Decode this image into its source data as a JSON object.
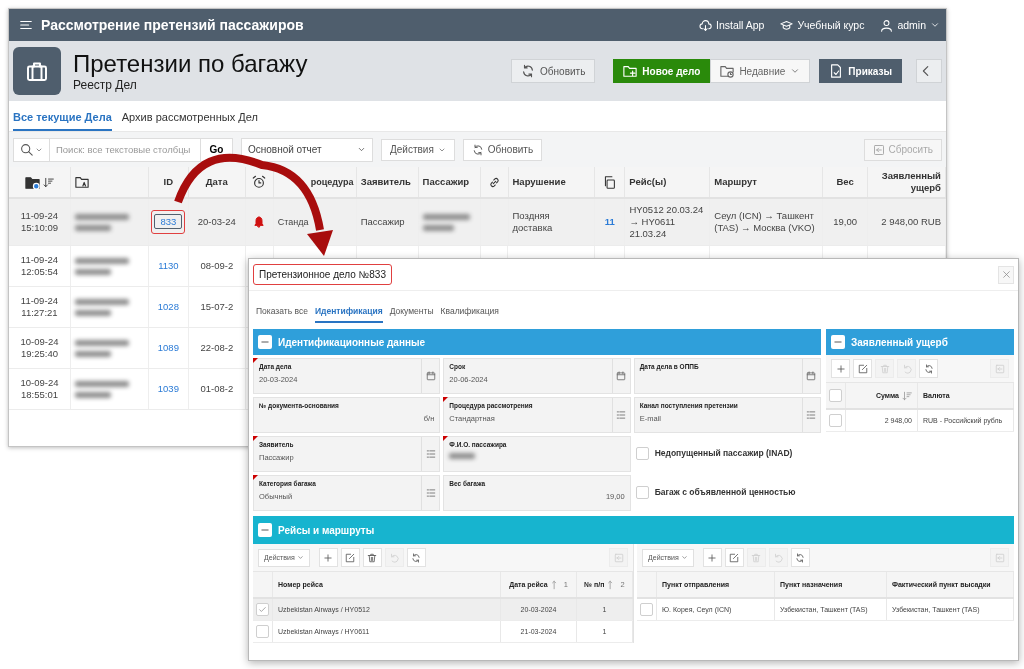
{
  "main_window": {
    "app_title": "Рассмотрение претензий пассажиров",
    "header_links": [
      {
        "kind": "install",
        "label": "Install App"
      },
      {
        "kind": "course",
        "label": "Учебный курс"
      },
      {
        "kind": "user",
        "label": "admin"
      }
    ],
    "page_title": "Претензии по багажу",
    "page_subtitle": "Реестр Дел",
    "hero_buttons": [
      {
        "kind": "refresh",
        "label": "Обновить"
      },
      {
        "kind": "new",
        "label": "Новое дело"
      },
      {
        "kind": "recent",
        "label": "Недавние"
      },
      {
        "kind": "orders",
        "label": "Приказы"
      },
      {
        "kind": "collapse"
      }
    ],
    "tabs": [
      {
        "label": "Все текущие Дела",
        "selected": true
      },
      {
        "label": "Архив рассмотренных Дел",
        "selected": false
      }
    ],
    "toolbar": {
      "search_placeholder": "Поиск: все текстовые столбцы",
      "go_label": "Go",
      "report": "Основной отчет",
      "actions_label": "Действия",
      "refresh_label": "Обновить",
      "reset_label": "Сбросить",
      "reset_disabled": true
    },
    "table": {
      "columns": [
        {
          "kind": "folder-sort"
        },
        {
          "kind": "folder"
        },
        {
          "kind": "text",
          "label": "ID"
        },
        {
          "kind": "text",
          "label": "Дата"
        },
        {
          "kind": "alarm"
        },
        {
          "kind": "text",
          "label": "роцедура"
        },
        {
          "kind": "text",
          "label": "Заявитель"
        },
        {
          "kind": "text",
          "label": "Пассажир"
        },
        {
          "kind": "link"
        },
        {
          "kind": "text",
          "label": "Нарушение"
        },
        {
          "kind": "copy"
        },
        {
          "kind": "text",
          "label": "Рейс(ы)"
        },
        {
          "kind": "text",
          "label": "Маршрут"
        },
        {
          "kind": "text",
          "label": "Вес"
        },
        {
          "kind": "text",
          "label": "Заявленный ущерб"
        }
      ],
      "rows": [
        {
          "selected": true,
          "created": "11-09-24 15:10:09",
          "applicant_hidden": true,
          "id": "833",
          "id_highlighted": true,
          "date": "20-03-24",
          "alarm": true,
          "procedure": "Станда",
          "claimant": "Пассажир",
          "passenger_hidden": true,
          "violation": "Поздняя доставка",
          "docs": "11",
          "flights": "HY0512 20.03.24 → HY0611 21.03.24",
          "route": "Сеул (ICN) → Ташкент (TAS) → Москва (VKO)",
          "weight": "19,00",
          "damage": "2 948,00 RUB"
        },
        {
          "selected": false,
          "created": "11-09-24 12:05:54",
          "applicant_hidden": true,
          "id": "1130",
          "date": "08-09-2"
        },
        {
          "selected": false,
          "created": "11-09-24 11:27:21",
          "applicant_hidden": true,
          "id": "1028",
          "date": "15-07-2"
        },
        {
          "selected": false,
          "created": "10-09-24 19:25:40",
          "applicant_hidden": true,
          "id": "1089",
          "date": "22-08-2"
        },
        {
          "selected": false,
          "created": "10-09-24 18:55:01",
          "applicant_hidden": true,
          "id": "1039",
          "date": "01-08-2"
        }
      ]
    }
  },
  "dialog": {
    "title": "Претензионное дело №833",
    "title_highlighted": true,
    "tabs": [
      {
        "label": "Показать все",
        "selected": false
      },
      {
        "label": "Идентификация",
        "selected": true
      },
      {
        "label": "Документы",
        "selected": false
      },
      {
        "label": "Квалификация",
        "selected": false
      }
    ],
    "identification": {
      "title": "Идентификационные данные",
      "fields": [
        {
          "kind": "date",
          "label": "Дата дела",
          "value": "20-03-2024",
          "required": true
        },
        {
          "kind": "date",
          "label": "Срок",
          "value": "20-06-2024",
          "required": false
        },
        {
          "kind": "date",
          "label": "Дата дела в ОППБ",
          "required": false
        },
        {
          "kind": "number",
          "label": "№ документа-основания",
          "value": "б/н",
          "required": false
        },
        {
          "kind": "select",
          "label": "Процедура рассмотрения",
          "value": "Стандартная",
          "required": true
        },
        {
          "kind": "select",
          "label": "Канал поступления претензии",
          "value": "E-mail",
          "required": false
        },
        {
          "kind": "select",
          "label": "Заявитель",
          "value": "Пассажир",
          "required": true
        },
        {
          "kind": "redacted",
          "label": "Ф.И.О. пассажира",
          "required": true
        },
        {
          "kind": "checkbox",
          "label": "Недопущенный пассажир (INAD)",
          "checked": false
        },
        {
          "kind": "select",
          "label": "Категория багажа",
          "value": "Обычный",
          "required": true
        },
        {
          "kind": "number",
          "label": "Вес багажа",
          "value": "19,00",
          "required": false
        },
        {
          "kind": "checkbox",
          "label": "Багаж с объявленной ценностью",
          "checked": false
        }
      ]
    },
    "damage": {
      "title": "Заявленный ущерб",
      "select_all_checked": false,
      "tools": [
        {
          "kind": "add",
          "disabled": false
        },
        {
          "kind": "edit",
          "disabled": false
        },
        {
          "kind": "delete",
          "disabled": true
        },
        {
          "kind": "undo",
          "disabled": true
        },
        {
          "kind": "refresh",
          "disabled": false
        },
        {
          "kind": "reset",
          "disabled": true
        }
      ],
      "columns": [
        {
          "label": "Сумма",
          "sorted_desc": true
        },
        {
          "label": "Валюта"
        }
      ],
      "rows": [
        {
          "selected": false,
          "cells": [
            "2 948,00",
            "RUB - Российский рубль"
          ]
        }
      ]
    },
    "flights_section": {
      "title": "Рейсы и маршруты",
      "flights": {
        "actions_label": "Действия",
        "tools": [
          {
            "kind": "add",
            "disabled": false
          },
          {
            "kind": "edit",
            "disabled": false
          },
          {
            "kind": "delete",
            "disabled": false
          },
          {
            "kind": "undo",
            "disabled": true
          },
          {
            "kind": "refresh",
            "disabled": false
          },
          {
            "kind": "reset",
            "disabled": true
          }
        ],
        "columns": [
          {
            "label": "Номер рейса"
          },
          {
            "label": "Дата рейса",
            "sorted_asc": true,
            "sort_order": "1"
          },
          {
            "label": "№ п/п",
            "sorted_asc": true,
            "sort_order": "2"
          }
        ],
        "rows": [
          {
            "selected": true,
            "cells": [
              "Uzbekistan Airways / HY0512",
              "20-03-2024",
              "1"
            ]
          },
          {
            "selected": false,
            "cells": [
              "Uzbekistan Airways / HY0611",
              "21-03-2024",
              "1"
            ]
          }
        ]
      },
      "routes": {
        "actions_label": "Действия",
        "tools": [
          {
            "kind": "add",
            "disabled": false
          },
          {
            "kind": "edit",
            "disabled": false
          },
          {
            "kind": "delete",
            "disabled": true
          },
          {
            "kind": "undo",
            "disabled": true
          },
          {
            "kind": "refresh",
            "disabled": false
          },
          {
            "kind": "reset",
            "disabled": true
          }
        ],
        "columns": [
          {
            "label": "Пункт отправления"
          },
          {
            "label": "Пункт назначения"
          },
          {
            "label": "Фактический пункт высадки"
          }
        ],
        "rows": [
          {
            "selected": false,
            "cells": [
              "Ю. Корея, Сеул (ICN)",
              "Узбекистан, Ташкент (TAS)",
              "Узбекистан, Ташкент (TAS)"
            ]
          }
        ]
      }
    }
  }
}
